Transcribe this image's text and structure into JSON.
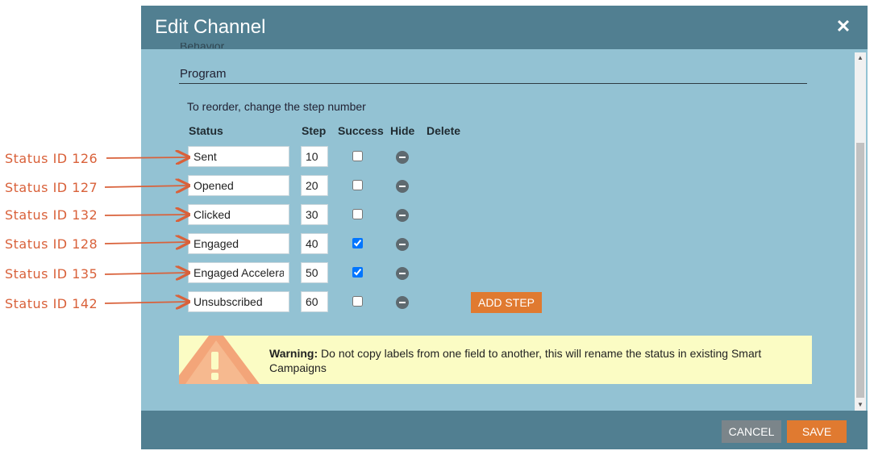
{
  "modal": {
    "title": "Edit Channel"
  },
  "content": {
    "cut_off_label": "Behavior",
    "section_title": "Program",
    "hint": "To reorder, change the step number",
    "columns": {
      "status": "Status",
      "step": "Step",
      "success": "Success",
      "hide": "Hide",
      "delete": "Delete"
    },
    "rows": [
      {
        "status": "Sent",
        "step": "10",
        "success": false
      },
      {
        "status": "Opened",
        "step": "20",
        "success": false
      },
      {
        "status": "Clicked",
        "step": "30",
        "success": false
      },
      {
        "status": "Engaged",
        "step": "40",
        "success": true
      },
      {
        "status": "Engaged Accelerated",
        "step": "50",
        "success": true
      },
      {
        "status": "Unsubscribed",
        "step": "60",
        "success": false
      }
    ],
    "add_step_label": "ADD STEP",
    "warning": {
      "label": "Warning:",
      "text": "Do not copy labels from one field to another, this will rename the status in existing Smart Campaigns"
    }
  },
  "footer": {
    "cancel_label": "CANCEL",
    "save_label": "SAVE"
  },
  "annotations": [
    "Status ID 126",
    "Status ID 127",
    "Status ID 132",
    "Status ID 128",
    "Status ID 135",
    "Status ID 142"
  ],
  "colors": {
    "header": "#517f91",
    "body": "#93c2d3",
    "accent_orange": "#e07a30",
    "annotation": "#d9613a",
    "warning_bg": "#fbfcc4"
  }
}
